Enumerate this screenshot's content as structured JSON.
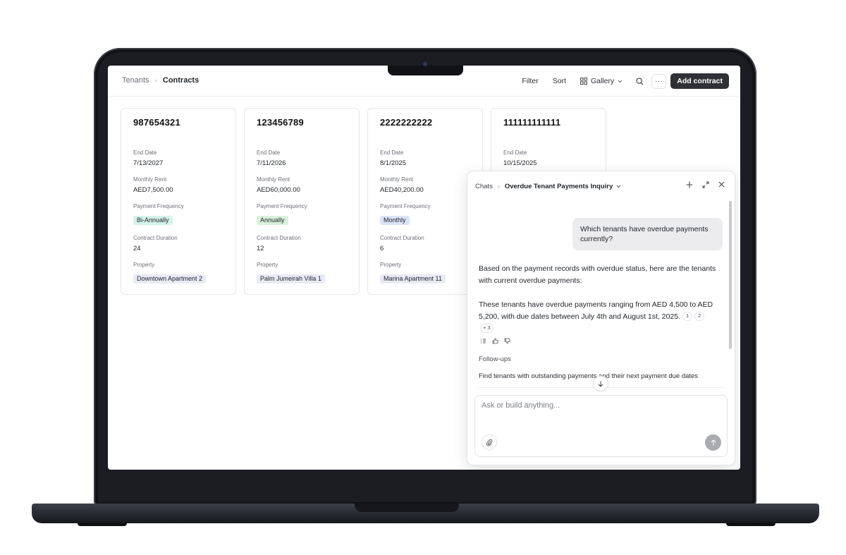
{
  "header": {
    "breadcrumb_root": "Tenants",
    "breadcrumb_current": "Contracts",
    "filter_label": "Filter",
    "sort_label": "Sort",
    "view_label": "Gallery",
    "more_label": "···",
    "add_label": "Add contract"
  },
  "cards": [
    {
      "number": "987654321",
      "end_date_label": "End Date",
      "end_date": "7/13/2027",
      "rent_label": "Monthly Rent",
      "rent": "AED7,500.00",
      "frequency_label": "Payment Frequency",
      "frequency": "Bi-Annually",
      "duration_label": "Contract Duration",
      "duration": "24",
      "property_label": "Property",
      "property": "Downtown Apartment 2"
    },
    {
      "number": "123456789",
      "end_date_label": "End Date",
      "end_date": "7/11/2026",
      "rent_label": "Monthly Rent",
      "rent": "AED60,000.00",
      "frequency_label": "Payment Frequency",
      "frequency": "Annually",
      "duration_label": "Contract Duration",
      "duration": "12",
      "property_label": "Property",
      "property": "Palm Jumeirah Villa 1"
    },
    {
      "number": "2222222222",
      "end_date_label": "End Date",
      "end_date": "8/1/2025",
      "rent_label": "Monthly Rent",
      "rent": "AED40,200.00",
      "frequency_label": "Payment Frequency",
      "frequency": "Monthly",
      "duration_label": "Contract Duration",
      "duration": "6",
      "property_label": "Property",
      "property": "Marina Apartment 11"
    },
    {
      "number": "111111111111",
      "end_date_label": "End Date",
      "end_date": "10/15/2025"
    }
  ],
  "chat": {
    "breadcrumb_root": "Chats",
    "title": "Overdue Tenant Payments Inquiry",
    "user_message": "Which tenants have overdue payments currently?",
    "answer_p1": "Based on the payment records with overdue status, here are the tenants with current overdue payments:",
    "answer_p2": "These tenants have overdue payments ranging from AED 4,500 to AED 5,200, with due dates between July 4th and August 1st, 2025.",
    "citations": [
      "1",
      "2",
      "+ 3"
    ],
    "followups_title": "Follow-ups",
    "followup_1": "Find tenants with outstanding payments and their next payment due dates",
    "composer_placeholder": "Ask or build anything..."
  },
  "colors": {
    "primary_button": "#2f3136",
    "bi_annually_pill": "#d4f2ea",
    "annually_pill": "#d7f1dc",
    "monthly_pill": "#dbe3f7",
    "property_pill": "#e8ebf5"
  }
}
